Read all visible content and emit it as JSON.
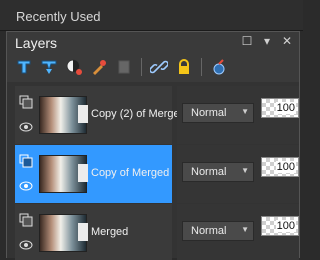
{
  "recent": {
    "title": "Recently Used"
  },
  "panel": {
    "title": "Layers"
  },
  "window_controls": [
    "☐",
    "▾",
    "✕"
  ],
  "toolbar": [
    "new-raster-layer-icon",
    "new-vector-layer-icon",
    "new-adjustment-layer-icon",
    "new-mask-layer-icon",
    "delete-layer-icon",
    "link-layers-icon",
    "lock-transparency-icon",
    "layer-properties-icon"
  ],
  "layers": [
    {
      "name": "Copy (2) of Merged",
      "blend": "Normal",
      "opacity": "100",
      "selected": false
    },
    {
      "name": "Copy of Merged",
      "blend": "Normal",
      "opacity": "100",
      "selected": true
    },
    {
      "name": "Merged",
      "blend": "Normal",
      "opacity": "100",
      "selected": false
    }
  ],
  "colors": {
    "accent": "#3399ff",
    "panel": "#3a3a3a",
    "background": "#2b2b2b"
  }
}
